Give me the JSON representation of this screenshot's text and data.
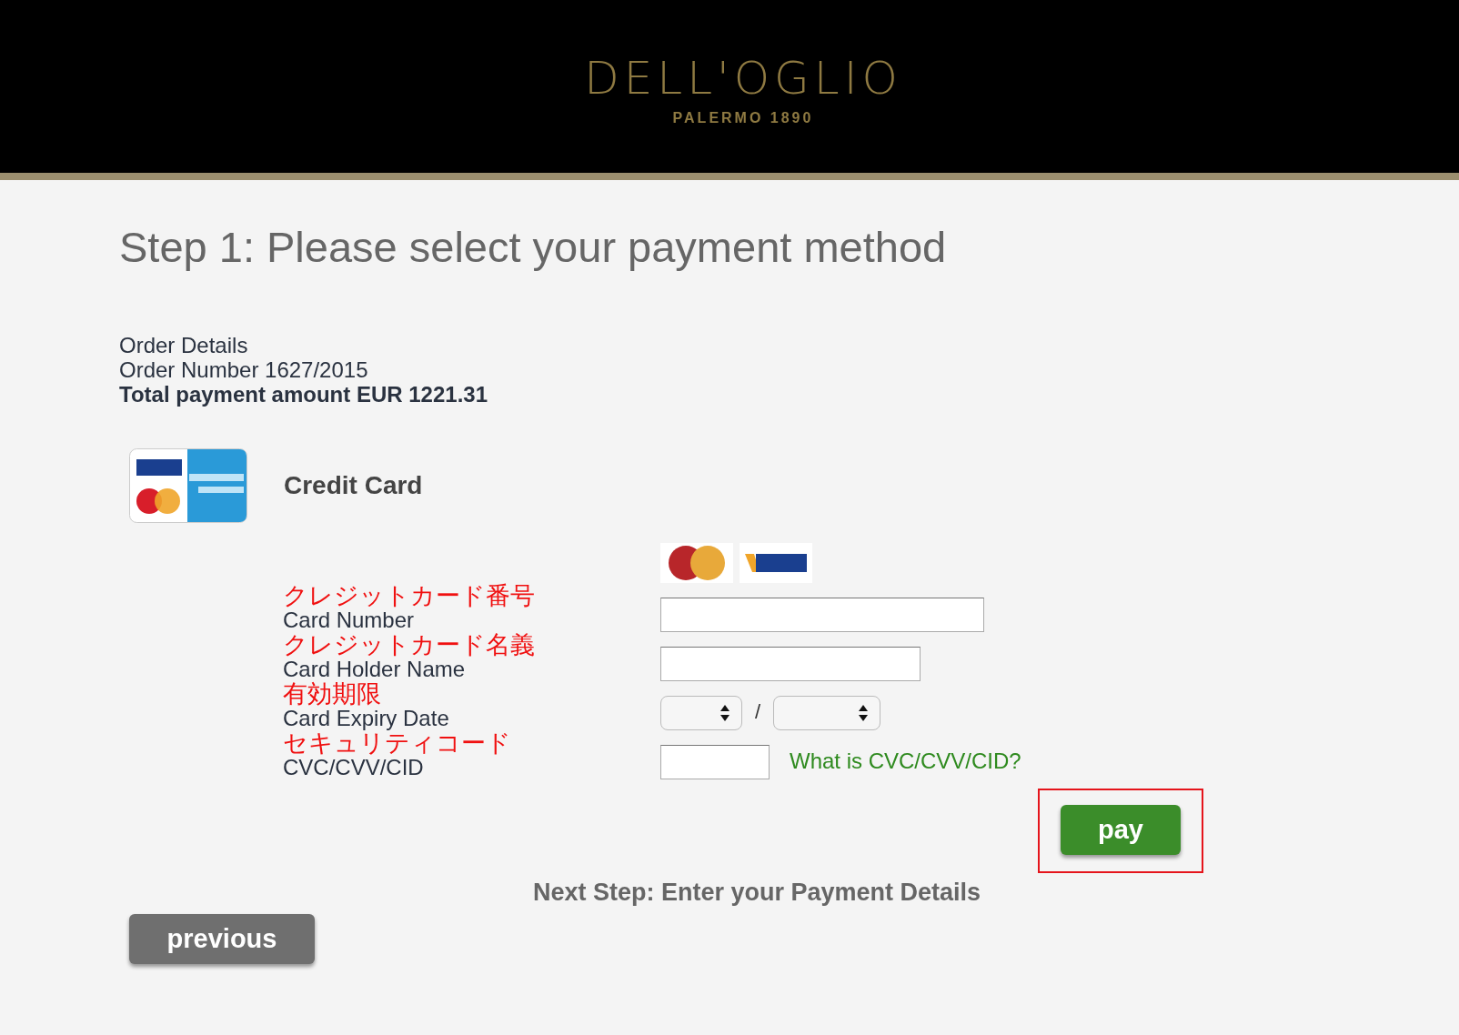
{
  "header": {
    "brand": "DELL'OGLIO",
    "tagline": "PALERMO 1890"
  },
  "title": "Step 1: Please select your payment method",
  "order": {
    "details": "Order Details",
    "number": "Order Number 1627/2015",
    "total": "Total payment amount EUR 1221.31"
  },
  "payment_method": {
    "label": "Credit Card"
  },
  "fields": [
    {
      "kind": "card-number",
      "label_ja": "クレジットカード番号",
      "label": "Card Number"
    },
    {
      "kind": "holder-name",
      "label_ja": "クレジットカード名義",
      "label": "Card Holder Name"
    },
    {
      "kind": "expiry",
      "label_ja": "有効期限",
      "label": "Card Expiry Date",
      "separator": "/"
    },
    {
      "kind": "cvc",
      "label_ja": "セキュリティコード",
      "label": "CVC/CVV/CID",
      "help_link": "What is CVC/CVV/CID?"
    }
  ],
  "pay_button": {
    "label": "pay",
    "highlighted": true
  },
  "next_step": "Next Step: Enter your Payment Details",
  "previous_button": {
    "label": "previous"
  }
}
